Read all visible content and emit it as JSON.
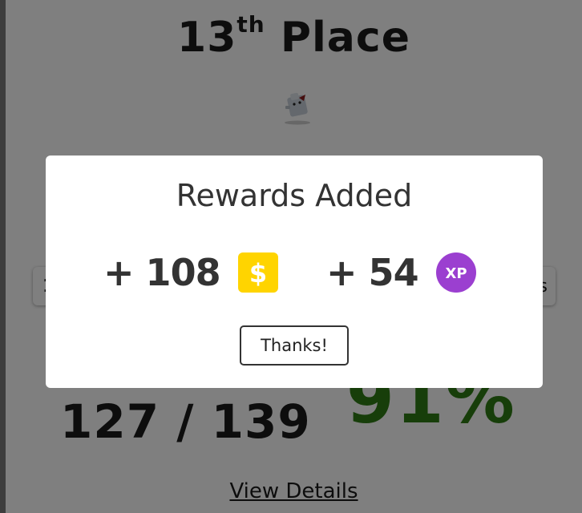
{
  "results": {
    "place_number": "13",
    "place_suffix": "th",
    "place_word": "Place",
    "left_stat_partial": "1",
    "right_stat_partial": "s",
    "score": "127 / 139",
    "accuracy": "91%",
    "view_details_label": "View Details"
  },
  "modal": {
    "title": "Rewards Added",
    "coins_amount": "+ 108",
    "coin_icon": "dollar-coin-icon",
    "coin_symbol": "$",
    "xp_amount": "+ 54",
    "xp_icon": "xp-badge-icon",
    "xp_symbol": "XP",
    "thanks_label": "Thanks!"
  },
  "colors": {
    "accuracy_green": "#2e7d14",
    "coin_yellow": "#ffd400",
    "xp_purple": "#9b3fd0"
  }
}
